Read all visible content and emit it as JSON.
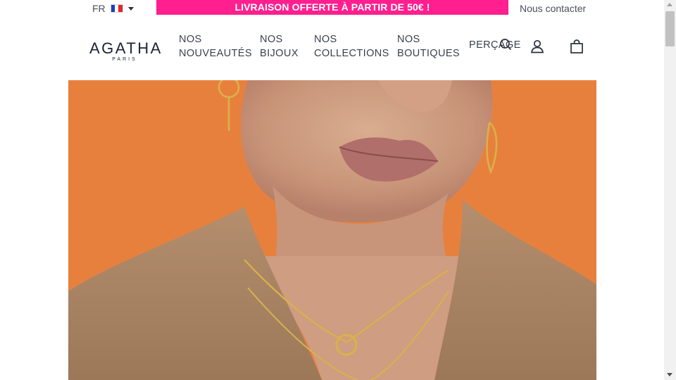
{
  "topbar": {
    "language": "FR",
    "flag_colors": [
      "#1d3fbb",
      "#ffffff",
      "#e0262f"
    ],
    "promo_text": "LIVRAISON OFFERTE À PARTIR DE 50€ !",
    "promo_color": "#ff1f8e",
    "contact_link": "Nous contacter"
  },
  "header": {
    "logo": {
      "word": "AGATHA",
      "sub": "PARIS"
    },
    "nav": [
      {
        "line1": "NOS",
        "line2": "NOUVEAUTÉS"
      },
      {
        "line1": "NOS",
        "line2": "BIJOUX"
      },
      {
        "line1": "NOS",
        "line2": "COLLECTIONS"
      },
      {
        "line1": "NOS",
        "line2": "BOUTIQUES"
      },
      {
        "line1": "PERÇAGE"
      }
    ],
    "icons": [
      "search-icon",
      "account-icon",
      "cart-icon"
    ]
  },
  "hero": {
    "background_color": "#e8803d",
    "image_subject": "model-with-gold-necklaces"
  }
}
